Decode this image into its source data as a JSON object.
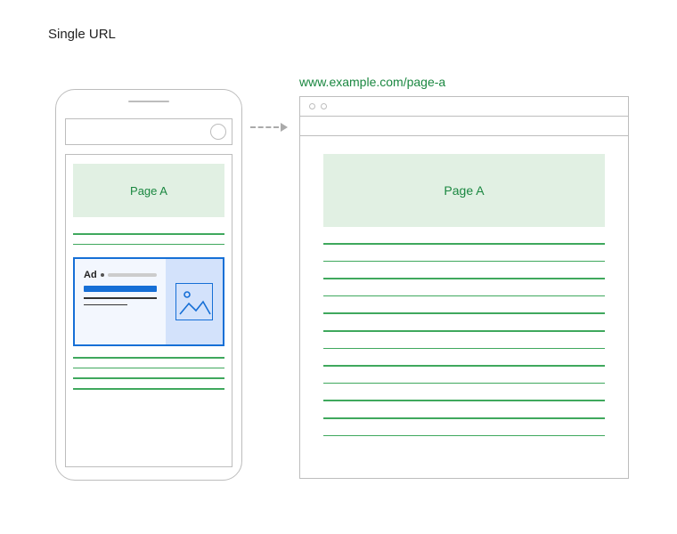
{
  "header": {
    "title": "Single URL"
  },
  "url": {
    "label": "www.example.com/page-a"
  },
  "mobile": {
    "hero_label": "Page A",
    "ad_label": "Ad"
  },
  "desktop": {
    "hero_label": "Page A"
  }
}
